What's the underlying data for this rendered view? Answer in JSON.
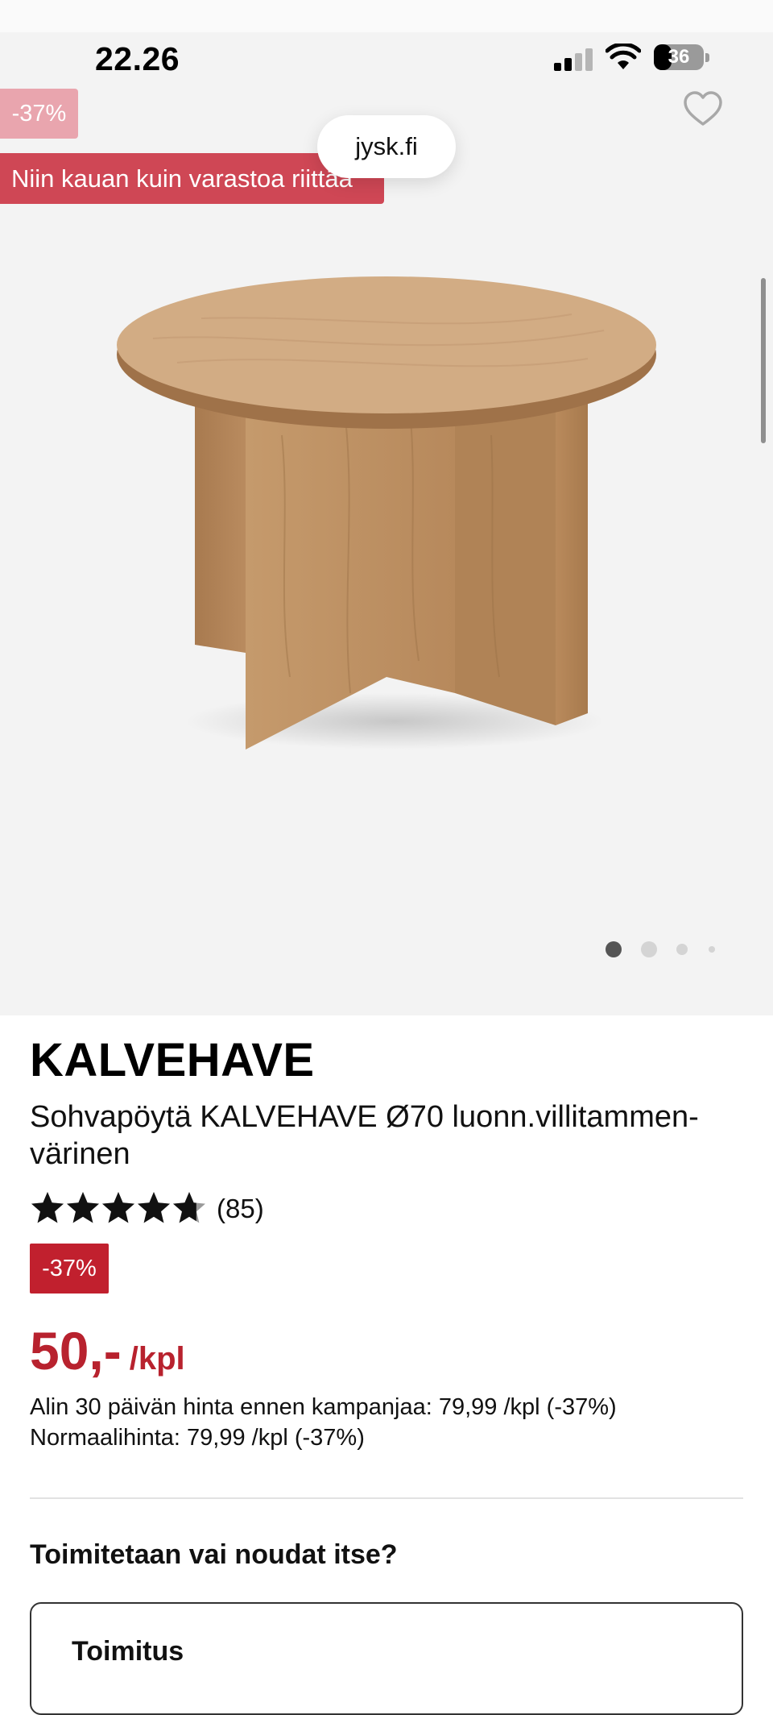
{
  "status_bar": {
    "time": "22.26",
    "battery": "36",
    "battery_level": 0.36
  },
  "browser": {
    "url": "jysk.fi"
  },
  "gallery": {
    "discount_badge": "-37%",
    "campaign_banner": "Niin kauan kuin varastoa riittää",
    "active_index": 0,
    "total_images": 4
  },
  "product": {
    "brand": "KALVEHAVE",
    "title": "Sohvapöytä KALVEHAVE Ø70 luonn.villitammen-värinen",
    "rating": 4.7,
    "rating_max": 5,
    "review_count": "(85)",
    "discount_badge": "-37%",
    "price": "50,-",
    "unit": "/kpl",
    "lowest_price_note": "Alin 30 päivän hinta ennen kampanjaa: 79,99 /kpl (-37%)",
    "normal_price_note": "Normaalihinta: 79,99 /kpl (-37%)"
  },
  "delivery": {
    "heading": "Toimitetaan vai noudat itse?",
    "option_label": "Toimitus"
  },
  "colors": {
    "sale_red": "#c1202e",
    "price_red": "#b8222e",
    "banner_red": "#cf4755",
    "hero_background": "#f3f3f3"
  },
  "icons": [
    "signal-icon",
    "wifi-icon",
    "battery-icon",
    "heart-icon",
    "star-icon"
  ]
}
